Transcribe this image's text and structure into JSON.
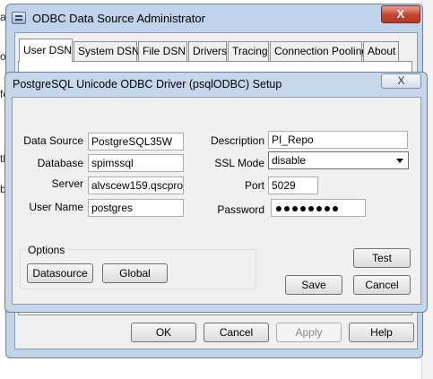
{
  "background": {
    "fragments": [
      "al",
      "or",
      "fo",
      "tl",
      "b"
    ]
  },
  "outer_window": {
    "title": "ODBC Data Source Administrator",
    "close_label": "X",
    "tabs": [
      {
        "label": "User DSN"
      },
      {
        "label": "System DSN"
      },
      {
        "label": "File DSN"
      },
      {
        "label": "Drivers"
      },
      {
        "label": "Tracing"
      },
      {
        "label": "Connection Pooling"
      },
      {
        "label": "About"
      }
    ],
    "buttons": {
      "ok": "OK",
      "cancel": "Cancel",
      "apply": "Apply",
      "help": "Help"
    }
  },
  "setup_dialog": {
    "title": "PostgreSQL Unicode ODBC Driver (psqlODBC) Setup",
    "close_label": "X",
    "fields": {
      "data_source": {
        "label": "Data Source",
        "value": "PostgreSQL35W"
      },
      "database": {
        "label": "Database",
        "value": "spimssql"
      },
      "server": {
        "label": "Server",
        "value": "alvscew159.qscprod."
      },
      "user_name": {
        "label": "User Name",
        "value": "postgres"
      },
      "description": {
        "label": "Description",
        "value": "PI_Repo"
      },
      "ssl_mode": {
        "label": "SSL Mode",
        "value": "disable"
      },
      "port": {
        "label": "Port",
        "value": "5029"
      },
      "password": {
        "label": "Password",
        "masked_length": 8
      }
    },
    "options": {
      "legend": "Options",
      "datasource_button": "Datasource",
      "global_button": "Global"
    },
    "buttons": {
      "test": "Test",
      "save": "Save",
      "cancel": "Cancel"
    }
  }
}
